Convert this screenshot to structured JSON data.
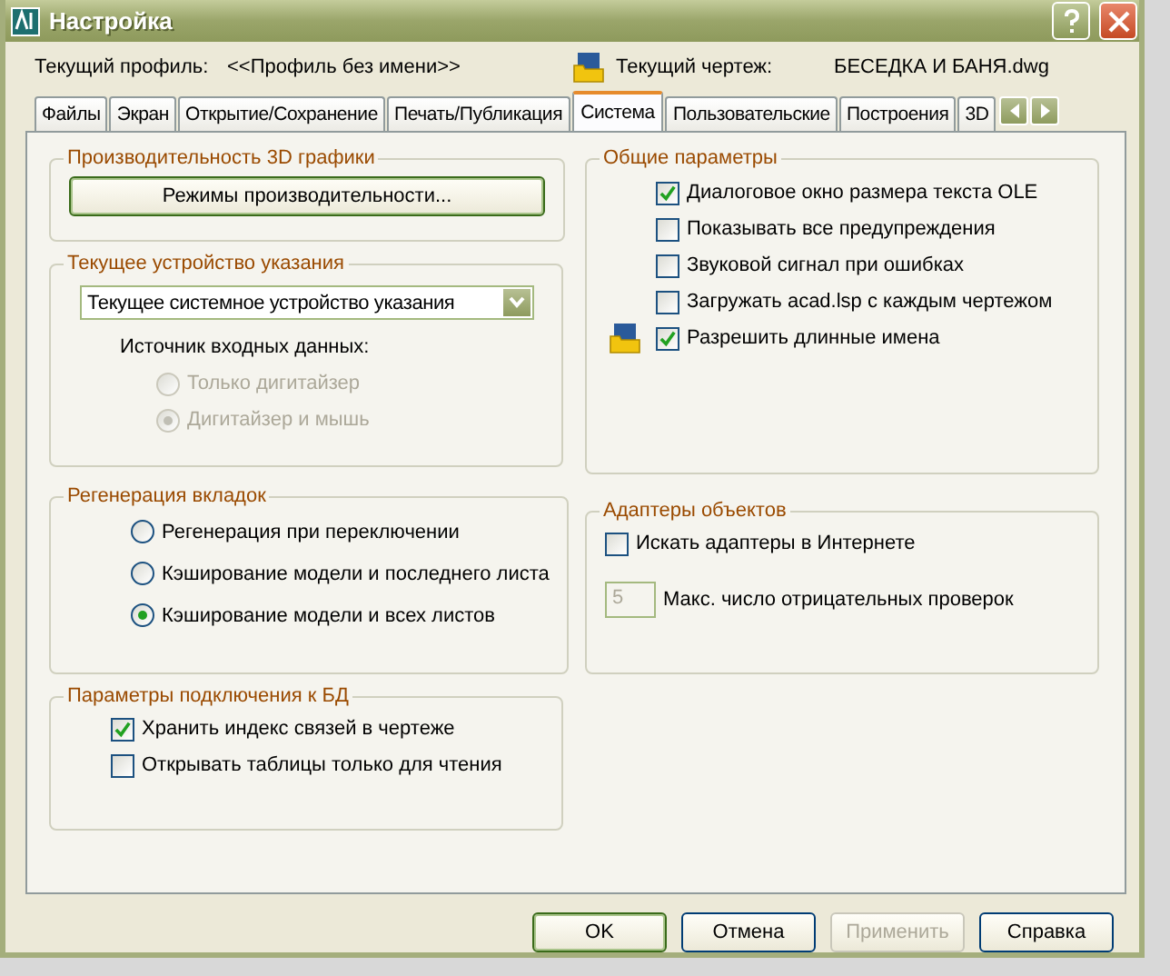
{
  "window": {
    "title": "Настройка"
  },
  "header": {
    "profile_label": "Текущий профиль:",
    "profile_value": "<<Профиль без имени>>",
    "drawing_label": "Текущий чертеж:",
    "drawing_value": "БЕСЕДКА И БАНЯ.dwg"
  },
  "tabs": [
    {
      "label": "Файлы",
      "selected": false
    },
    {
      "label": "Экран",
      "selected": false
    },
    {
      "label": "Открытие/Сохранение",
      "selected": false
    },
    {
      "label": "Печать/Публикация",
      "selected": false
    },
    {
      "label": "Система",
      "selected": true
    },
    {
      "label": "Пользовательские",
      "selected": false
    },
    {
      "label": "Построения",
      "selected": false
    },
    {
      "label": "3D",
      "selected": false
    }
  ],
  "graphics_performance": {
    "title": "Производительность 3D графики",
    "button": "Режимы производительности..."
  },
  "pointing_device": {
    "title": "Текущее устройство указания",
    "dropdown_value": "Текущее системное устройство указания",
    "input_label": "Источник входных данных:",
    "options": [
      {
        "label": "Только дигитайзер",
        "selected": false,
        "disabled": true
      },
      {
        "label": "Дигитайзер и мышь",
        "selected": true,
        "disabled": true
      }
    ]
  },
  "general_options": {
    "title": "Общие параметры",
    "items": [
      {
        "label": "Диалоговое окно размера текста OLE",
        "checked": true,
        "icon": false
      },
      {
        "label": "Показывать все предупреждения",
        "checked": false,
        "icon": false
      },
      {
        "label": "Звуковой сигнал при ошибках",
        "checked": false,
        "icon": false
      },
      {
        "label": "Загружать acad.lsp с каждым чертежом",
        "checked": false,
        "icon": false
      },
      {
        "label": "Разрешить длинные имена",
        "checked": true,
        "icon": true
      }
    ]
  },
  "layout_regen": {
    "title": "Регенерация вкладок",
    "options": [
      {
        "label": "Регенерация при переключении",
        "selected": false
      },
      {
        "label": "Кэширование модели и последнего листа",
        "selected": false
      },
      {
        "label": "Кэширование модели и всех листов",
        "selected": true
      }
    ]
  },
  "object_enablers": {
    "title": "Адаптеры объектов",
    "checkbox": {
      "label": "Искать адаптеры в Интернете",
      "checked": false
    },
    "field_value": "5",
    "field_label": "Макс. число отрицательных проверок",
    "field_disabled": true
  },
  "db_connect": {
    "title": "Параметры подключения к БД",
    "items": [
      {
        "label": "Хранить индекс связей в чертеже",
        "checked": true
      },
      {
        "label": "Открывать таблицы только для чтения",
        "checked": false
      }
    ]
  },
  "buttons": [
    {
      "label": "OK",
      "default": true,
      "disabled": false
    },
    {
      "label": "Отмена",
      "default": false,
      "disabled": false
    },
    {
      "label": "Применить",
      "default": false,
      "disabled": true
    },
    {
      "label": "Справка",
      "default": false,
      "disabled": false
    }
  ]
}
